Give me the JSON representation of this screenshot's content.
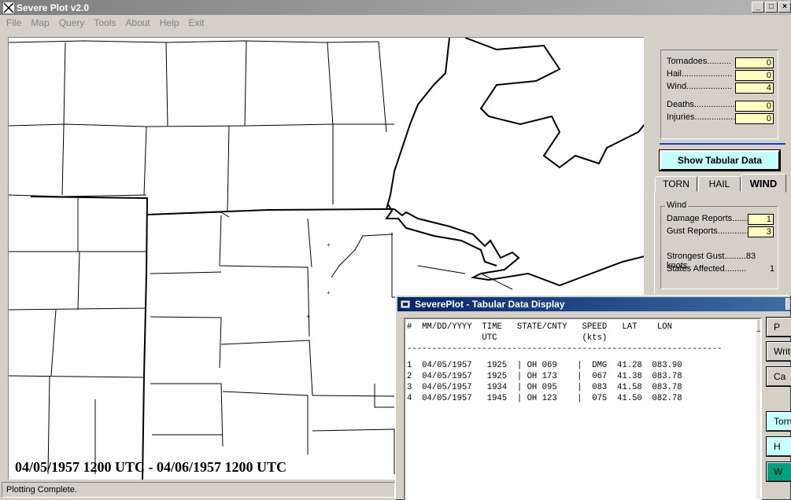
{
  "window": {
    "title": "Severe Plot v2.0"
  },
  "menu": [
    "File",
    "Map",
    "Query",
    "Tools",
    "About",
    "Help",
    "Exit"
  ],
  "map": {
    "date_range": "04/05/1957 1200 UTC - 04/06/1957 1200 UTC"
  },
  "status": "Plotting Complete.",
  "stats": {
    "tornadoes_label": "Tornadoes..........",
    "tornadoes": "0",
    "hail_label": "Hail.....................",
    "hail": "0",
    "wind_label": "Wind...................",
    "wind": "4",
    "deaths_label": "Deaths.................",
    "deaths": "0",
    "injuries_label": "Injuries.................",
    "injuries": "0"
  },
  "show_tabular_button": "Show Tabular Data",
  "tabs": [
    "TORN",
    "HAIL",
    "WIND"
  ],
  "wind_group": {
    "title": "Wind",
    "damage_label": "Damage Reports..........",
    "damage": "1",
    "gust_label": "Gust Reports.............",
    "gust": "3",
    "strongest_gust": "Strongest Gust.........83 knots",
    "states_affected_label": "States Affected.........",
    "states_affected": "1"
  },
  "tabular": {
    "title": "SeverePlot - Tabular Data Display",
    "header1": "#  MM/DD/YYYY  TIME   STATE/CNTY   SPEED   LAT    LON",
    "header2": "               UTC                 (kts)",
    "divider": "---------------------------------------------------------------",
    "rows": [
      "1  04/05/1957   1925  | OH 069    |  DMG  41.28  083.90",
      "2  04/05/1957   1925  | OH 173    |  067  41.38  083.78",
      "3  04/05/1957   1934  | OH 095    |  083  41.58  083.78",
      "4  04/05/1957   1945  | OH 123    |  075  41.50  082.78"
    ],
    "side_buttons": [
      "P",
      "Write",
      "Ca",
      "Torn",
      "H",
      "W"
    ]
  },
  "icons": [
    "app-icon",
    "minimize-icon",
    "maximize-icon",
    "close-icon",
    "table-window-icon",
    "scroll-up-icon"
  ]
}
